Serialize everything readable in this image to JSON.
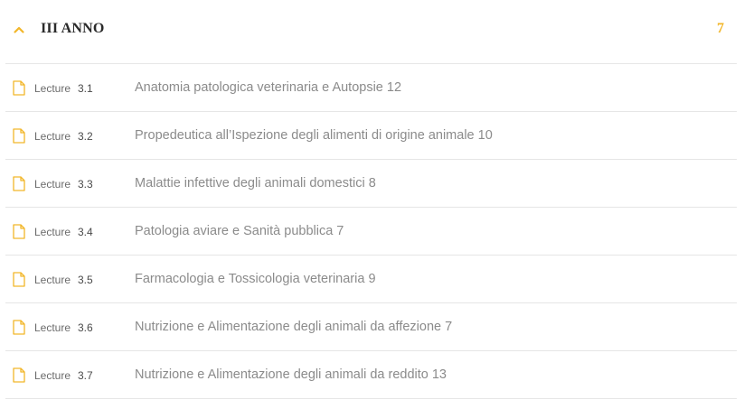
{
  "section": {
    "title": "III ANNO",
    "count": "7",
    "accent_color": "#f2b62a",
    "toggle_icon": "chevron-up-icon",
    "lesson_icon": "file-icon"
  },
  "lessons": [
    {
      "label": "Lecture",
      "number": "3.1",
      "title": "Anatomia patologica veterinaria e Autopsie 12"
    },
    {
      "label": "Lecture",
      "number": "3.2",
      "title": "Propedeutica all’Ispezione degli alimenti di origine animale 10"
    },
    {
      "label": "Lecture",
      "number": "3.3",
      "title": "Malattie infettive degli animali domestici 8"
    },
    {
      "label": "Lecture",
      "number": "3.4",
      "title": "Patologia aviare e Sanità pubblica 7"
    },
    {
      "label": "Lecture",
      "number": "3.5",
      "title": "Farmacologia e Tossicologia veterinaria 9"
    },
    {
      "label": "Lecture",
      "number": "3.6",
      "title": "Nutrizione e Alimentazione degli animali da affezione 7"
    },
    {
      "label": "Lecture",
      "number": "3.7",
      "title": "Nutrizione e Alimentazione degli animali da reddito 13"
    }
  ]
}
